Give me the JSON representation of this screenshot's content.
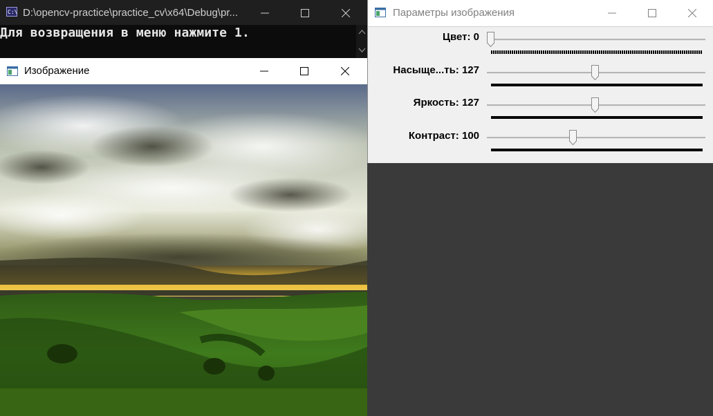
{
  "console": {
    "title": "D:\\opencv-practice\\practice_cv\\x64\\Debug\\pr...",
    "text": "Для возвращения в меню нажмите 1.",
    "icon": "console-app-icon"
  },
  "image_window": {
    "title": "Изображение",
    "icon": "opencv-window-icon"
  },
  "params_window": {
    "title": "Параметры изображения",
    "icon": "opencv-window-icon",
    "sliders": [
      {
        "label": "Цвет: 0",
        "value": 0,
        "max": 255
      },
      {
        "label": "Насыще...ть: 127",
        "value": 127,
        "max": 255
      },
      {
        "label": "Яркость: 127",
        "value": 127,
        "max": 255
      },
      {
        "label": "Контраст: 100",
        "value": 100,
        "max": 255
      }
    ]
  },
  "colors": {
    "console_bg": "#0c0c0c",
    "desktop_bg": "#3a3a3a",
    "panel_bg": "#f0f0f0"
  }
}
